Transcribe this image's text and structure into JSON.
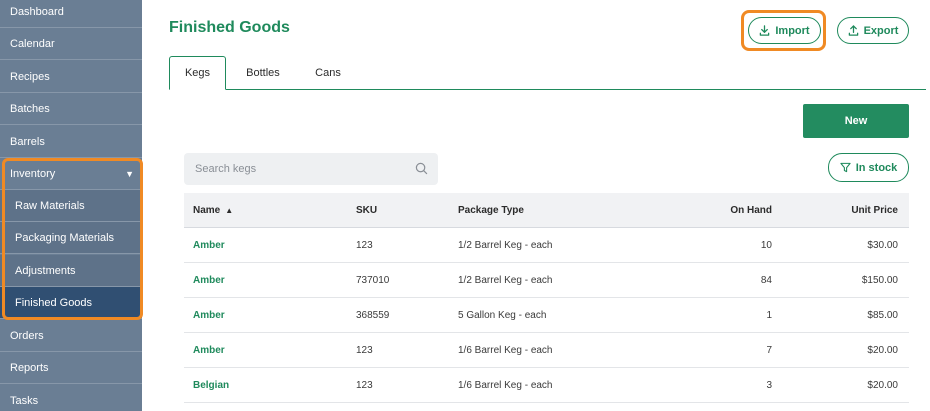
{
  "sidebar": {
    "items": [
      {
        "label": "Dashboard"
      },
      {
        "label": "Calendar"
      },
      {
        "label": "Recipes"
      },
      {
        "label": "Batches"
      },
      {
        "label": "Barrels"
      },
      {
        "label": "Inventory",
        "caret": "▼"
      },
      {
        "label": "Raw Materials"
      },
      {
        "label": "Packaging Materials"
      },
      {
        "label": "Adjustments"
      },
      {
        "label": "Finished Goods"
      },
      {
        "label": "Orders"
      },
      {
        "label": "Reports"
      },
      {
        "label": "Tasks"
      }
    ]
  },
  "header": {
    "title": "Finished Goods",
    "import_label": "Import",
    "export_label": "Export"
  },
  "tabs": [
    {
      "label": "Kegs"
    },
    {
      "label": "Bottles"
    },
    {
      "label": "Cans"
    }
  ],
  "toolbar": {
    "new_label": "New",
    "search_placeholder": "Search kegs",
    "filter_label": "In stock"
  },
  "table": {
    "headers": {
      "name": "Name",
      "name_sort": "▲",
      "sku": "SKU",
      "package_type": "Package Type",
      "on_hand": "On Hand",
      "unit_price": "Unit Price"
    },
    "rows": [
      {
        "name": "Amber",
        "sku": "123",
        "package_type": "1/2 Barrel Keg - each",
        "on_hand": "10",
        "unit_price": "$30.00"
      },
      {
        "name": "Amber",
        "sku": "737010",
        "package_type": "1/2 Barrel Keg - each",
        "on_hand": "84",
        "unit_price": "$150.00"
      },
      {
        "name": "Amber",
        "sku": "368559",
        "package_type": "5 Gallon Keg - each",
        "on_hand": "1",
        "unit_price": "$85.00"
      },
      {
        "name": "Amber",
        "sku": "123",
        "package_type": "1/6 Barrel Keg - each",
        "on_hand": "7",
        "unit_price": "$20.00"
      },
      {
        "name": "Belgian",
        "sku": "123",
        "package_type": "1/6 Barrel Keg - each",
        "on_hand": "3",
        "unit_price": "$20.00"
      }
    ]
  },
  "colors": {
    "accent": "#1f8a5c",
    "sidebar": "#6a7e94",
    "sidebar_active": "#304f72",
    "highlight": "#f08a24"
  }
}
